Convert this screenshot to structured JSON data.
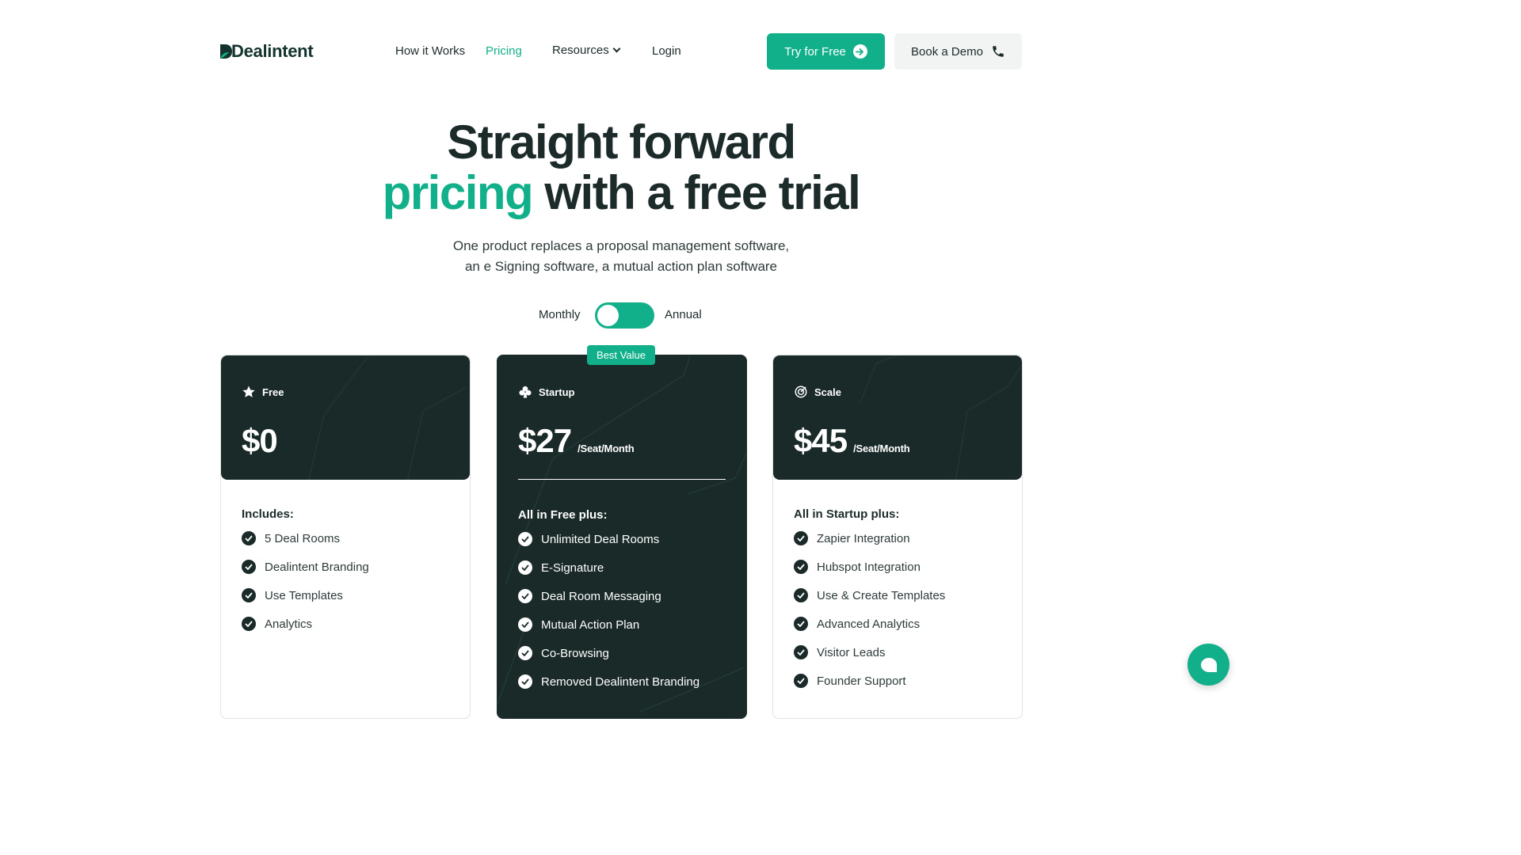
{
  "brand": {
    "name": "Dealintent",
    "accent": "#12b08a",
    "dark": "#1a2a28"
  },
  "nav": {
    "items": [
      {
        "label": "How it Works"
      },
      {
        "label": "Pricing"
      },
      {
        "label": "Resources"
      },
      {
        "label": "Login"
      }
    ],
    "active": "Pricing"
  },
  "header": {
    "try_label": "Try for Free",
    "demo_label": "Book a Demo"
  },
  "hero": {
    "title_line1": "Straight forward",
    "title_accent": "pricing",
    "title_rest": " with a free trial",
    "sub_line1": "One product replaces a proposal management software,",
    "sub_line2": "an e Signing software, a mutual action plan software"
  },
  "billing": {
    "monthly": "Monthly",
    "annual": "Annual"
  },
  "plans": [
    {
      "name": "Free",
      "icon": "star-icon",
      "price": "$0",
      "per": "",
      "includes_title": "Includes:",
      "features": [
        "5 Deal Rooms",
        "Dealintent Branding",
        "Use Templates",
        "Analytics"
      ]
    },
    {
      "name": "Startup",
      "icon": "club-icon",
      "badge": "Best Value",
      "price": "$27",
      "per": "/Seat/Month",
      "includes_title": "All in Free plus:",
      "features": [
        "Unlimited Deal Rooms",
        "E-Signature",
        "Deal Room Messaging",
        "Mutual Action Plan",
        "Co-Browsing",
        "Removed Dealintent Branding"
      ]
    },
    {
      "name": "Scale",
      "icon": "target-icon",
      "price": "$45",
      "per": "/Seat/Month",
      "includes_title": "All in Startup plus:",
      "features": [
        "Zapier Integration",
        "Hubspot Integration",
        "Use & Create Templates",
        "Advanced Analytics",
        "Visitor Leads",
        "Founder Support"
      ]
    }
  ]
}
